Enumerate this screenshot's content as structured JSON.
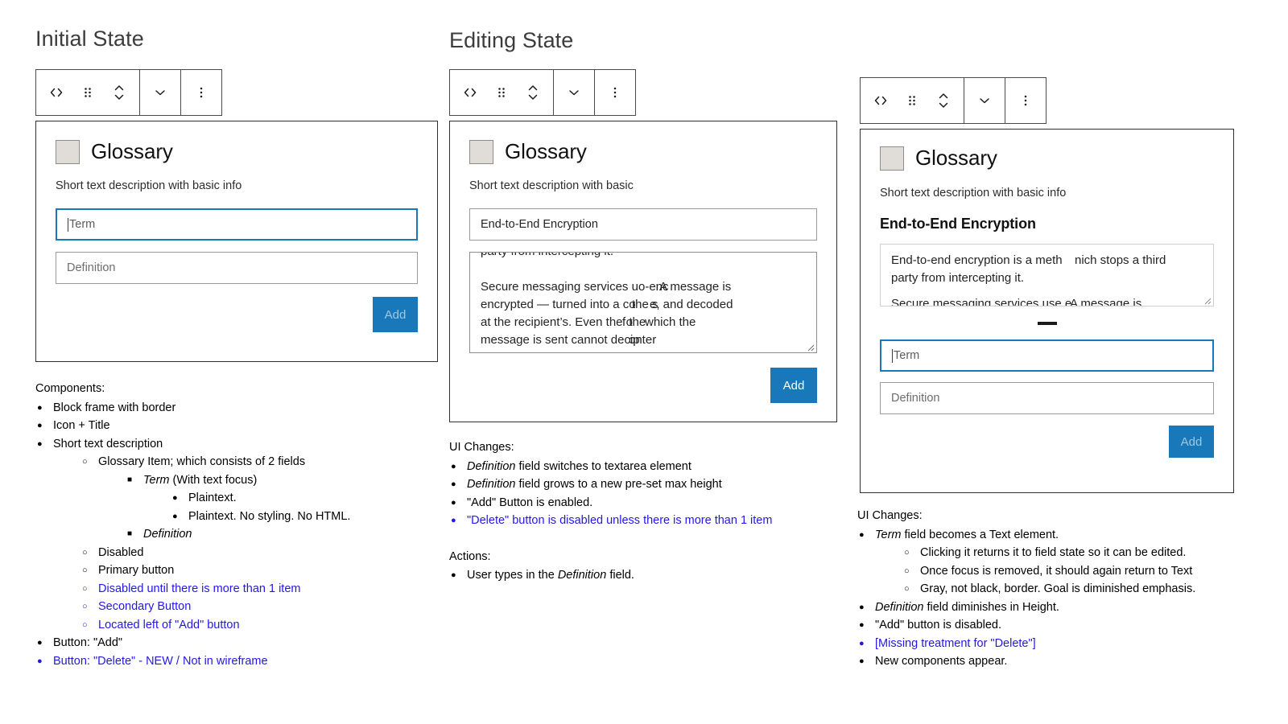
{
  "accent": {
    "primary_blue": "#1878b9",
    "note_blue": "#2417e8",
    "disabled_label": "#9cc9e6",
    "icon_fill": "#e0ddd8"
  },
  "columns": {
    "initial": {
      "heading": "Initial State",
      "card": {
        "title": "Glossary",
        "description": "Short text description with basic info",
        "term_placeholder": "Term",
        "definition_placeholder": "Definition",
        "add_label": "Add",
        "add_state": "disabled"
      },
      "notes_title": "Components:",
      "notes": [
        {
          "text": "Block frame with border",
          "level": 1,
          "blue": false,
          "italic_lead": ""
        },
        {
          "text": "Icon + Title",
          "level": 1,
          "blue": false,
          "italic_lead": ""
        },
        {
          "text": "Short text description",
          "level": 1,
          "blue": false,
          "italic_lead": ""
        },
        {
          "text": "Glossary Item; which consists of 2 fields",
          "level": 2,
          "blue": false,
          "italic_lead": ""
        },
        {
          "text": "(With text focus)",
          "level": 3,
          "blue": false,
          "italic_lead": "Term"
        },
        {
          "text": "Plaintext.",
          "level": 4,
          "blue": false,
          "italic_lead": ""
        },
        {
          "text": "",
          "level": 3,
          "blue": false,
          "italic_lead": "Definition"
        },
        {
          "text": "Plaintext. No styling. No HTML.",
          "level": 4,
          "blue": false,
          "italic_lead": ""
        },
        {
          "text": "Button: \"Add\"",
          "level": 1,
          "blue": false,
          "italic_lead": ""
        },
        {
          "text": "Disabled",
          "level": 2,
          "blue": false,
          "italic_lead": ""
        },
        {
          "text": "Primary button",
          "level": 2,
          "blue": false,
          "italic_lead": ""
        },
        {
          "text": "Button: \"Delete\" - NEW / Not in wireframe",
          "level": 1,
          "blue": true,
          "italic_lead": ""
        },
        {
          "text": "Disabled until there is more than 1 item",
          "level": 2,
          "blue": true,
          "italic_lead": ""
        },
        {
          "text": "Secondary Button",
          "level": 2,
          "blue": true,
          "italic_lead": ""
        },
        {
          "text": "Located left of \"Add\" button",
          "level": 2,
          "blue": true,
          "italic_lead": ""
        }
      ]
    },
    "editing": {
      "heading": "Editing State",
      "card": {
        "title": "Glossary",
        "description": "Short text description with basic",
        "term_value": "End-to-End Encryption",
        "definition_clipped_top": "party from intercepting it.",
        "definition_lines": [
          "Secure messaging services u",
          "encrypted — turned into a co",
          "at the recipient’s. Even the o",
          "message is sent cannot decip"
        ],
        "definition_overlay": [
          "o-enc",
          "the s",
          "f the",
          "onter"
        ],
        "definition_overlay2": [
          "A message is",
          "e, and decoded",
          " which the",
          ""
        ],
        "add_label": "Add",
        "add_state": "enabled"
      },
      "notes_title": "UI Changes:",
      "notes": [
        {
          "text": "field switches to textarea element",
          "level": 1,
          "blue": false,
          "italic_lead": "Definition"
        },
        {
          "text": "field grows to a new pre-set max height",
          "level": 1,
          "blue": false,
          "italic_lead": "Definition"
        },
        {
          "text": "\"Add\" Button is enabled.",
          "level": 1,
          "blue": false,
          "italic_lead": ""
        },
        {
          "text": "\"Delete\" button is disabled unless there is more than 1 item",
          "level": 1,
          "blue": true,
          "italic_lead": ""
        }
      ],
      "actions_title": "Actions:",
      "actions": [
        {
          "text": "field.",
          "level": 1,
          "blue": false,
          "italic_lead": "",
          "prefix": "User types in the ",
          "italic_mid": "Definition"
        }
      ]
    },
    "final": {
      "card": {
        "title": "Glossary",
        "description": "Short text description with basic info",
        "term_static": "End-to-End Encryption",
        "definition_lines": [
          "End-to-end encryption is a meth",
          "party from intercepting it."
        ],
        "definition_overlay": [
          "nich stops a third",
          ""
        ],
        "definition_clipped_bottom": "Secure messaging services use e",
        "definition_clipped_bottom2": "A message is",
        "term_placeholder": "Term",
        "definition_placeholder": "Definition",
        "add_label": "Add",
        "add_state": "disabled"
      },
      "notes_title": "UI Changes:",
      "notes": [
        {
          "text": "field becomes a Text element.",
          "level": 1,
          "blue": false,
          "italic_lead": "Term"
        },
        {
          "text": "Clicking it returns it to field state so it can be edited.",
          "level": 2,
          "blue": false,
          "italic_lead": ""
        },
        {
          "text": "Once focus is removed, it should again return to Text",
          "level": 2,
          "blue": false,
          "italic_lead": ""
        },
        {
          "text": "field diminishes in Height.",
          "level": 1,
          "blue": false,
          "italic_lead": "Definition"
        },
        {
          "text": "Gray, not black, border. Goal is diminished emphasis.",
          "level": 2,
          "blue": false,
          "italic_lead": ""
        },
        {
          "text": "\"Add\" button is disabled.",
          "level": 1,
          "blue": false,
          "italic_lead": ""
        },
        {
          "text": "[Missing treatment for \"Delete\"]",
          "level": 1,
          "blue": true,
          "italic_lead": ""
        },
        {
          "text": "New components appear.",
          "level": 1,
          "blue": false,
          "italic_lead": ""
        }
      ]
    }
  },
  "toolbar": {
    "icons": [
      "code-icon",
      "drag-handle-icon",
      "move-updown-icon",
      "chevron-down-icon",
      "more-vertical-icon"
    ]
  }
}
